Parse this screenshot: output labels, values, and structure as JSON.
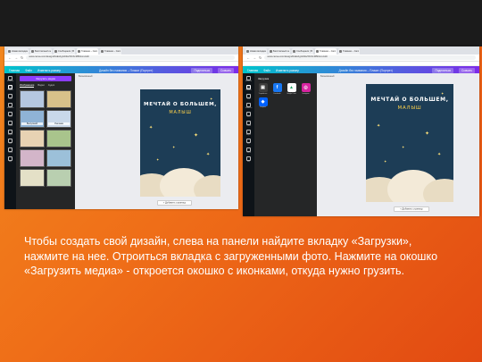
{
  "left": {
    "tabs": [
      "Новая вкладка",
      "Бесплатный онлайн…",
      "Сообщения | ВКонт…",
      "Главная – Canva",
      "Главная – Canva"
    ],
    "url": "www.canva.com/design/DAEshgGhI4k/XDrXcM5Fkxm/edit",
    "canva_menu": [
      "Главная",
      "Файл",
      "Изменить размер"
    ],
    "doc_title": "Дизайн без названия – Плакат (Портрет)",
    "share": "Поделиться",
    "download": "Скачать",
    "rail": [
      "Шаблоны",
      "Загрузки",
      "Фото",
      "Элементы",
      "Текст",
      "Стили",
      "Видео",
      "Фон",
      "Папки",
      "Ещё"
    ],
    "upload_button": "Загрузить медиа",
    "panel_tabs": [
      "Изображения",
      "Видео",
      "Аудио"
    ],
    "thumb_texts": [
      "",
      "",
      "Выпускной",
      "Реклама",
      "",
      "",
      "",
      "",
      "",
      ""
    ],
    "filename": "Безымянный"
  },
  "right": {
    "tabs": [
      "Новая вкладка",
      "Бесплатный онлайн…",
      "Сообщения | ВКонт…",
      "Главная – Canva",
      "Главная – Canva"
    ],
    "url": "www.canva.com/design/DAEshgGhI4k/XDrXcM5Fkxm/edit",
    "canva_menu": [
      "Главная",
      "Файл",
      "Изменить размер"
    ],
    "doc_title": "Дизайн без названия – Плакат (Портрет)",
    "share": "Поделиться",
    "download": "Скачать",
    "panel_title": "Загрузка",
    "apps": [
      {
        "label": "Устройство",
        "color": "#3d3d3d",
        "glyph": "▣"
      },
      {
        "label": "Facebook",
        "color": "#1877f2",
        "glyph": "f"
      },
      {
        "label": "Google Drive",
        "color": "#ffffff",
        "glyph": "▲"
      },
      {
        "label": "Instagram",
        "color": "#d6249f",
        "glyph": "◎"
      },
      {
        "label": "Dropbox",
        "color": "#0061ff",
        "glyph": "◆"
      }
    ],
    "filename": "Безымянный"
  },
  "design": {
    "title": "МЕЧТАЙ О БОЛЬШЕМ,",
    "subtitle": "МАЛЫШ",
    "add_page": "+ Добавить страницу",
    "colors": {
      "background": "#1d3d56",
      "title": "#ffffff",
      "subtitle": "#ffd24a",
      "star": "#ffe27a",
      "cloud": "#f3ead8"
    }
  },
  "caption": "Чтобы создать свой дизайн, слева на панели найдите вкладку «Загрузки», нажмите на нее. Отроиться вкладка с загруженными фото. Нажмите на окошко «Загрузить медиа» - откроется окошко с иконками, откуда нужно грузить."
}
